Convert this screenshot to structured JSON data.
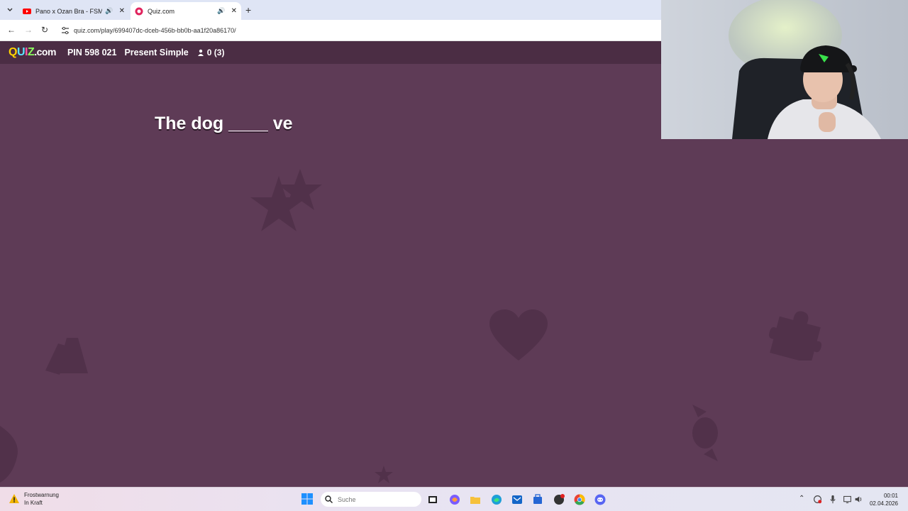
{
  "browser": {
    "tabs": [
      {
        "title": "Pano x Ozan Bra - FSM | ICO",
        "active": false
      },
      {
        "title": "Quiz.com",
        "active": true
      }
    ],
    "url": "quiz.com/play/699407dc-dceb-456b-bb0b-aa1f20a86170/"
  },
  "quiz": {
    "logo_q": "Q",
    "logo_u": "U",
    "logo_i": "I",
    "logo_z": "Z",
    "logo_suffix": ".com",
    "pin": "PIN 598 021",
    "title": "Present Simple",
    "players": "0 (3)",
    "question": "The dog ____ ve"
  },
  "taskbar": {
    "weather_title": "Frostwarnung",
    "weather_subtitle": "In Kraft",
    "search_placeholder": "Suche",
    "time": "00:01",
    "date": "02.04.2026"
  },
  "colors": {
    "background": "#5e3b56",
    "header": "#4b2d44",
    "deco": "#4f2f48"
  }
}
